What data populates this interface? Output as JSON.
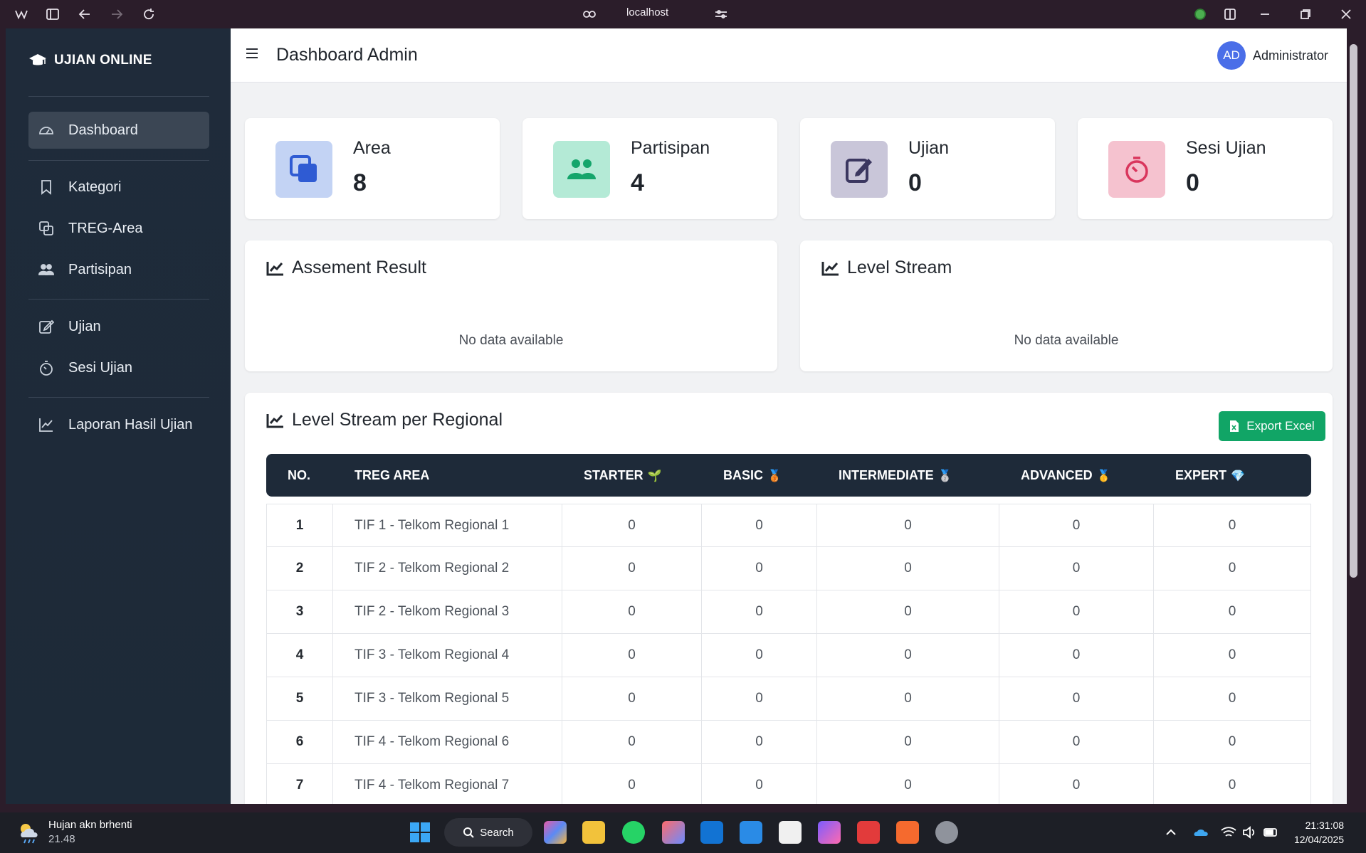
{
  "browser": {
    "address": "localhost"
  },
  "sidebar": {
    "brand": "UJIAN ONLINE",
    "items": [
      {
        "label": "Dashboard"
      },
      {
        "label": "Kategori"
      },
      {
        "label": "TREG-Area"
      },
      {
        "label": "Partisipan"
      },
      {
        "label": "Ujian"
      },
      {
        "label": "Sesi Ujian"
      },
      {
        "label": "Laporan Hasil Ujian"
      }
    ]
  },
  "header": {
    "title": "Dashboard Admin",
    "avatar_initials": "AD",
    "user_name": "Administrator"
  },
  "stats": [
    {
      "label": "Area",
      "value": "8",
      "color": "#c3d3f4"
    },
    {
      "label": "Partisipan",
      "value": "4",
      "color": "#b4ead6"
    },
    {
      "label": "Ujian",
      "value": "0",
      "color": "#c9c6d9"
    },
    {
      "label": "Sesi Ujian",
      "value": "0",
      "color": "#f5c2cf"
    }
  ],
  "cards": {
    "assessment": {
      "title": "Assement Result",
      "empty": "No data available"
    },
    "level_stream": {
      "title": "Level Stream",
      "empty": "No data available"
    }
  },
  "regional": {
    "title": "Level Stream per Regional",
    "export_label": "Export Excel",
    "columns": [
      "NO.",
      "TREG AREA",
      "STARTER",
      "BASIC",
      "INTERMEDIATE",
      "ADVANCED",
      "EXPERT"
    ],
    "column_emojis": [
      "",
      "",
      "🌱",
      "🥉",
      "🥈",
      "🥇",
      "💎"
    ],
    "rows": [
      {
        "no": "1",
        "area": "TIF 1 - Telkom Regional 1",
        "starter": "0",
        "basic": "0",
        "intermediate": "0",
        "advanced": "0",
        "expert": "0"
      },
      {
        "no": "2",
        "area": "TIF 2 - Telkom Regional 2",
        "starter": "0",
        "basic": "0",
        "intermediate": "0",
        "advanced": "0",
        "expert": "0"
      },
      {
        "no": "3",
        "area": "TIF 2 - Telkom Regional 3",
        "starter": "0",
        "basic": "0",
        "intermediate": "0",
        "advanced": "0",
        "expert": "0"
      },
      {
        "no": "4",
        "area": "TIF 3 - Telkom Regional 4",
        "starter": "0",
        "basic": "0",
        "intermediate": "0",
        "advanced": "0",
        "expert": "0"
      },
      {
        "no": "5",
        "area": "TIF 3 - Telkom Regional 5",
        "starter": "0",
        "basic": "0",
        "intermediate": "0",
        "advanced": "0",
        "expert": "0"
      },
      {
        "no": "6",
        "area": "TIF 4 - Telkom Regional 6",
        "starter": "0",
        "basic": "0",
        "intermediate": "0",
        "advanced": "0",
        "expert": "0"
      },
      {
        "no": "7",
        "area": "TIF 4 - Telkom Regional 7",
        "starter": "0",
        "basic": "0",
        "intermediate": "0",
        "advanced": "0",
        "expert": "0"
      }
    ]
  },
  "taskbar": {
    "weather_text": "Hujan akn brhenti",
    "weather_value": "21.48",
    "search_label": "Search",
    "time": "21:31:08",
    "date": "12/04/2025"
  }
}
